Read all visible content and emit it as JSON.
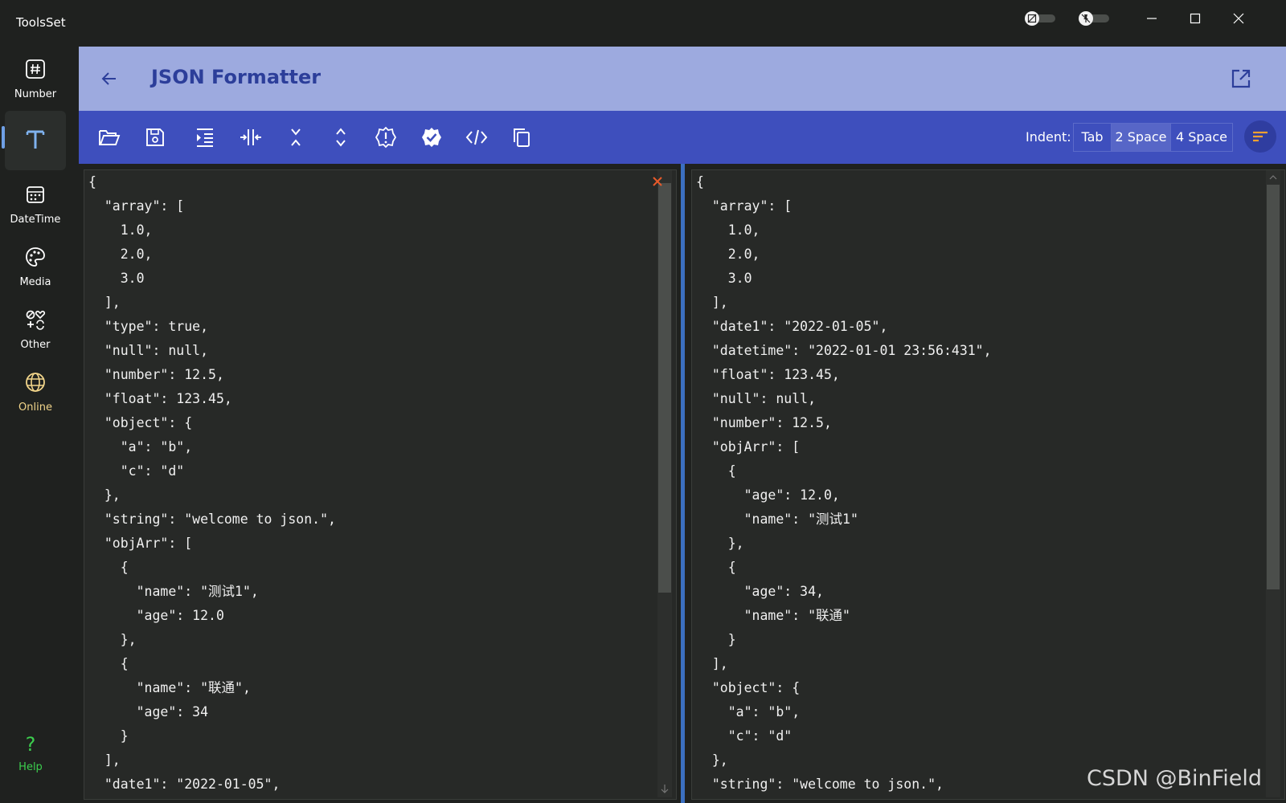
{
  "app": {
    "title": "ToolsSet"
  },
  "titlebar": {
    "toggle1_icon": "no-image-icon",
    "toggle2_icon": "unpin-icon",
    "minimize_icon": "minimize-icon",
    "maximize_icon": "maximize-icon",
    "close_icon": "close-icon"
  },
  "nav": {
    "items": [
      {
        "label": "Number",
        "icon": "hash-icon"
      },
      {
        "label": "",
        "icon": "text-icon",
        "active": true
      },
      {
        "label": "DateTime",
        "icon": "calendar-icon"
      },
      {
        "label": "Media",
        "icon": "palette-icon"
      },
      {
        "label": "Other",
        "icon": "shapes-icon"
      },
      {
        "label": "Online",
        "icon": "globe-icon"
      }
    ],
    "help": {
      "label": "Help",
      "symbol": "?"
    }
  },
  "header": {
    "title": "JSON Formatter",
    "back_icon": "arrow-left-icon",
    "open_icon": "open-external-icon"
  },
  "toolbar": {
    "buttons": [
      "open-folder-icon",
      "save-icon",
      "indent-icon",
      "compress-icon",
      "collapse-icon",
      "expand-icon",
      "validate-icon",
      "verified-icon",
      "code-icon",
      "copy-icon"
    ],
    "indent_label": "Indent:",
    "indent_options": [
      "Tab",
      "2 Space",
      "4 Space"
    ],
    "indent_selected": "2 Space",
    "sort_icon": "sort-icon"
  },
  "editors": {
    "left_text": "{\n  \"array\": [\n    1.0,\n    2.0,\n    3.0\n  ],\n  \"type\": true,\n  \"null\": null,\n  \"number\": 12.5,\n  \"float\": 123.45,\n  \"object\": {\n    \"a\": \"b\",\n    \"c\": \"d\"\n  },\n  \"string\": \"welcome to json.\",\n  \"objArr\": [\n    {\n      \"name\": \"测试1\",\n      \"age\": 12.0\n    },\n    {\n      \"name\": \"联通\",\n      \"age\": 34\n    }\n  ],\n  \"date1\": \"2022-01-05\",",
    "right_text": "{\n  \"array\": [\n    1.0,\n    2.0,\n    3.0\n  ],\n  \"date1\": \"2022-01-05\",\n  \"datetime\": \"2022-01-01 23:56:431\",\n  \"float\": 123.45,\n  \"null\": null,\n  \"number\": 12.5,\n  \"objArr\": [\n    {\n      \"age\": 12.0,\n      \"name\": \"测试1\"\n    },\n    {\n      \"age\": 34,\n      \"name\": \"联通\"\n    }\n  ],\n  \"object\": {\n    \"a\": \"b\",\n    \"c\": \"d\"\n  },\n  \"string\": \"welcome to json.\","
  },
  "watermark": "CSDN @BinField",
  "colors": {
    "header_bg": "#9daadf",
    "toolbar_bg": "#3e4fbd",
    "accent": "#3b6fc0",
    "online_label": "#f2d58a",
    "help": "#3ccf4e"
  }
}
